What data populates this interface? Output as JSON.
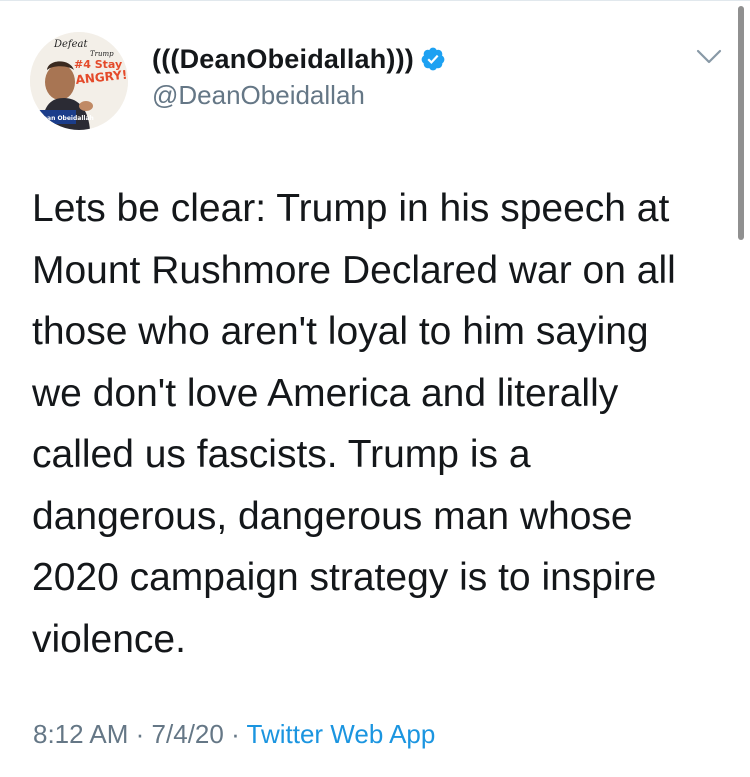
{
  "tweet": {
    "display_name": "(((DeanObeidallah)))",
    "handle": "@DeanObeidallah",
    "verified": true,
    "avatar": {
      "text_top": "Defeat",
      "text_trump": "Trump",
      "text_hashtag": "#4 Stay",
      "text_angry": "ANGRY!",
      "text_show": "Dean Obeidallah"
    },
    "text": "Lets be clear: Trump in his speech at\nMount Rushmore Declared war on all\nthose who aren't loyal to him saying\nwe don't love America and literally\ncalled us fascists. Trump is a\ndangerous, dangerous man whose\n2020 campaign strategy is to inspire\nviolence.",
    "time": "8:12 AM",
    "date": "7/4/20",
    "separator": "·",
    "source": "Twitter Web App"
  },
  "colors": {
    "text": "#14171a",
    "secondary": "#657786",
    "link": "#1b95e0",
    "verified": "#1da1f2"
  },
  "icons": {
    "verified": "verified-badge-icon",
    "caret": "chevron-down-icon"
  }
}
